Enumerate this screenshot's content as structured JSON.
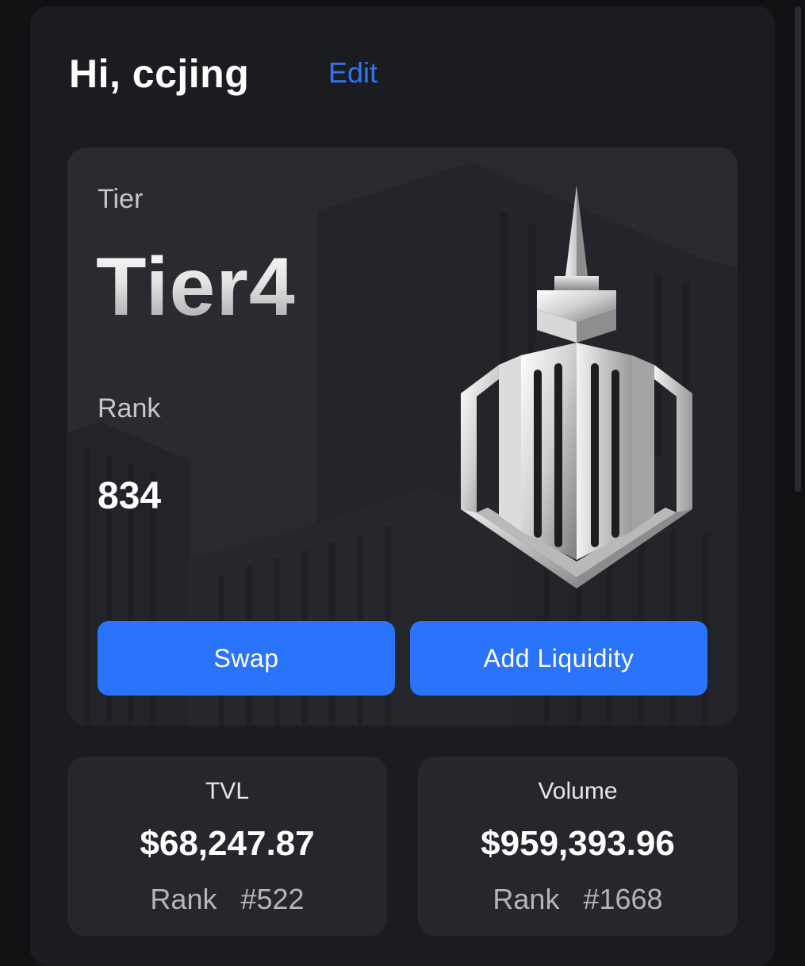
{
  "header": {
    "greeting": "Hi, ccjing",
    "edit_label": "Edit"
  },
  "tier_card": {
    "tier_label": "Tier",
    "tier_value": "Tier4",
    "rank_label": "Rank",
    "rank_value": "834",
    "emblem_icon": "skyscraper-hexagon-emblem-icon"
  },
  "actions": {
    "swap_label": "Swap",
    "add_liquidity_label": "Add Liquidity",
    "accent_color": "#2a73fb"
  },
  "stats": {
    "tvl": {
      "title": "TVL",
      "value": "$68,247.87",
      "rank_label": "Rank",
      "rank_value": "#522"
    },
    "volume": {
      "title": "Volume",
      "value": "$959,393.96",
      "rank_label": "Rank",
      "rank_value": "#1668"
    }
  },
  "colors": {
    "background": "#111114",
    "panel": "#1b1c20",
    "card": "#2a2b30",
    "link": "#2f76f5"
  }
}
